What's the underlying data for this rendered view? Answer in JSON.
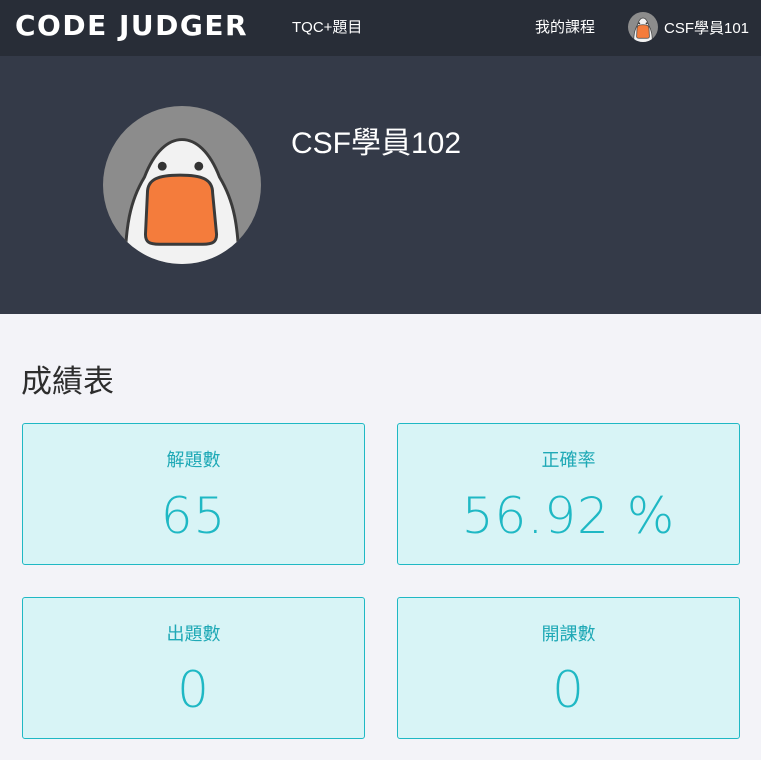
{
  "navbar": {
    "brand": "CODE JUDGER",
    "problems_link": "TQC+題目",
    "courses_link": "我的課程",
    "user_name": "CSF學員101",
    "avatar_icon": "duck-avatar-icon"
  },
  "profile": {
    "name": "CSF學員102",
    "avatar_icon": "duck-avatar-icon"
  },
  "scoreboard": {
    "title": "成績表",
    "cards": [
      {
        "label": "解題數",
        "value": "65"
      },
      {
        "label": "正確率",
        "value": "56.92 %"
      },
      {
        "label": "出題數",
        "value": "0"
      },
      {
        "label": "開課數",
        "value": "0"
      }
    ]
  },
  "colors": {
    "navbar_bg": "#282d37",
    "banner_bg": "#343a48",
    "page_bg": "#f3f3f8",
    "card_bg": "#d8f4f6",
    "accent": "#1fb8c4",
    "duck_beak": "#f47c3c"
  }
}
